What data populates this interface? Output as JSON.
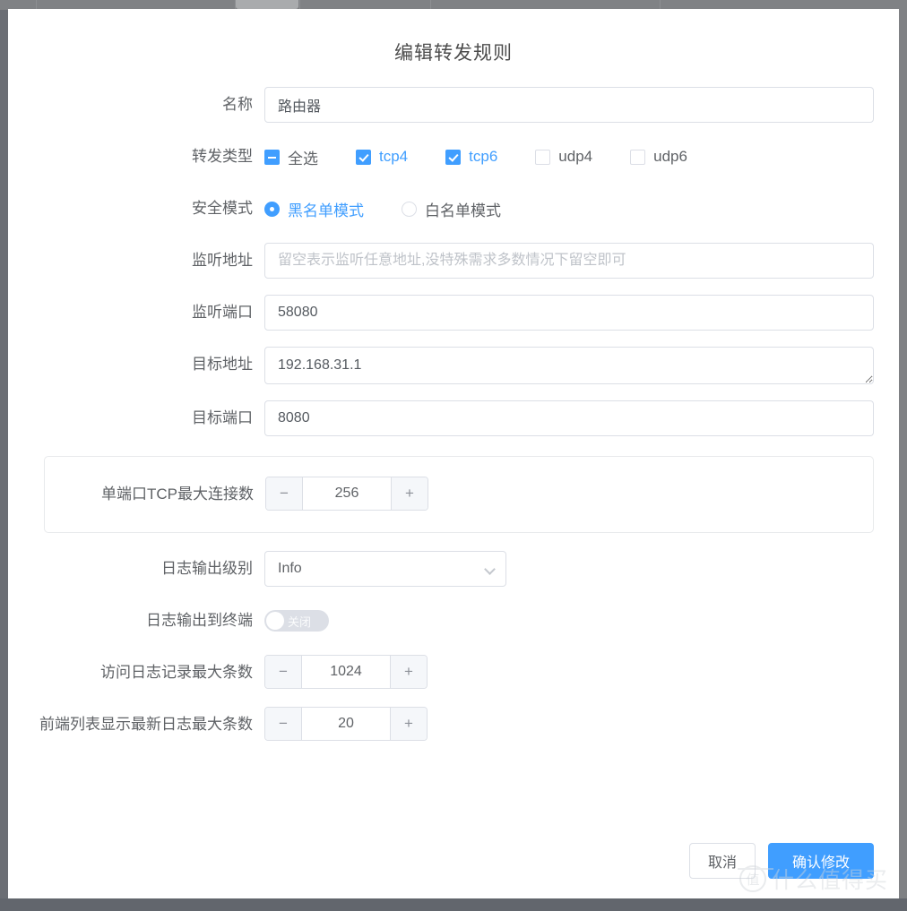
{
  "dialog": {
    "title": "编辑转发规则"
  },
  "fields": {
    "name": {
      "label": "名称",
      "value": "路由器",
      "placeholder": ""
    },
    "forward_type": {
      "label": "转发类型",
      "options": [
        {
          "label": "全选",
          "state": "indeterminate"
        },
        {
          "label": "tcp4",
          "state": "checked"
        },
        {
          "label": "tcp6",
          "state": "checked"
        },
        {
          "label": "udp4",
          "state": "unchecked"
        },
        {
          "label": "udp6",
          "state": "unchecked"
        }
      ]
    },
    "security_mode": {
      "label": "安全模式",
      "options": [
        {
          "label": "黑名单模式",
          "selected": true
        },
        {
          "label": "白名单模式",
          "selected": false
        }
      ]
    },
    "listen_address": {
      "label": "监听地址",
      "value": "",
      "placeholder": "留空表示监听任意地址,没特殊需求多数情况下留空即可"
    },
    "listen_port": {
      "label": "监听端口",
      "value": "58080",
      "placeholder": ""
    },
    "target_address": {
      "label": "目标地址",
      "value": "192.168.31.1",
      "placeholder": ""
    },
    "target_port": {
      "label": "目标端口",
      "value": "8080",
      "placeholder": ""
    },
    "max_tcp_conn": {
      "label": "单端口TCP最大连接数",
      "value": "256",
      "minus": "−",
      "plus": "+"
    },
    "log_level": {
      "label": "日志输出级别",
      "value": "Info"
    },
    "log_to_terminal": {
      "label": "日志输出到终端",
      "state_text": "关闭",
      "on": false
    },
    "max_access_log": {
      "label": "访问日志记录最大条数",
      "value": "1024",
      "minus": "−",
      "plus": "+"
    },
    "max_front_log": {
      "label": "前端列表显示最新日志最大条数",
      "value": "20",
      "minus": "−",
      "plus": "+"
    }
  },
  "footer": {
    "cancel_label": "取消",
    "confirm_label": "确认修改"
  },
  "watermark": {
    "mark": "值",
    "text": "什么值得买"
  },
  "colors": {
    "accent": "#409eff",
    "label": "#5f6266",
    "border": "#dcdfe6",
    "backdrop": "#7f8184"
  }
}
